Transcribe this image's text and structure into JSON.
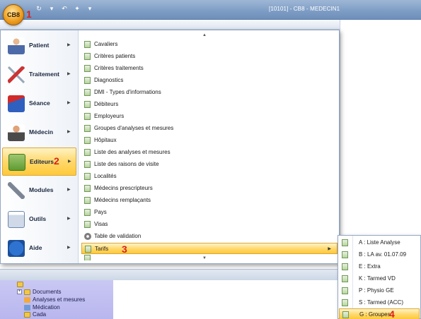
{
  "window": {
    "title": "[10101] - CB8 - MEDECIN1",
    "app_button_label": "CB8",
    "annotation_1": "1"
  },
  "main_menu": {
    "items": [
      {
        "label": "Patient",
        "icon": "patient-icon"
      },
      {
        "label": "Traitement",
        "icon": "syringe-icon"
      },
      {
        "label": "Séance",
        "icon": "seance-icon"
      },
      {
        "label": "Médecin",
        "icon": "doctor-icon"
      },
      {
        "label": "Editeurs",
        "icon": "editor-icon",
        "annotation": "2"
      },
      {
        "label": "Modules",
        "icon": "wrench-icon"
      },
      {
        "label": "Outils",
        "icon": "window-icon"
      },
      {
        "label": "Aide",
        "icon": "info-icon"
      }
    ],
    "active_index": 4
  },
  "editeurs_submenu": {
    "items": [
      "Cavaliers",
      "Critères patients",
      "Critères traitements",
      "Diagnostics",
      "DMI - Types d'informations",
      "Débiteurs",
      "Employeurs",
      "Groupes d'analyses et mesures",
      "Hôpitaux",
      "Liste des analyses et mesures",
      "Liste des raisons de visite",
      "Localités",
      "Médecins prescripteurs",
      "Médecins remplaçants",
      "Pays",
      "Visas",
      "Table de validation",
      "Tarifs"
    ],
    "active_label": "Tarifs",
    "annotation_3": "3"
  },
  "tarifs_flyout": {
    "items": [
      "A : Liste Analyse",
      "B : LA av. 01.07.09",
      "E : Extra",
      "K : Tarmed VD",
      "P : Physio GE",
      "S : Tarmed (ACC)",
      "G : Groupes"
    ],
    "active_label": "G : Groupes",
    "annotation_4": "4"
  },
  "background_tree": {
    "items": [
      "Documents",
      "Analyses et mesures",
      "Médication",
      "Cada"
    ]
  },
  "colors": {
    "highlight": "#ffd86b",
    "annotation_red": "#d9211c",
    "title_bar": "#7d9cc4",
    "tree_bg": "#c9c8f3"
  }
}
